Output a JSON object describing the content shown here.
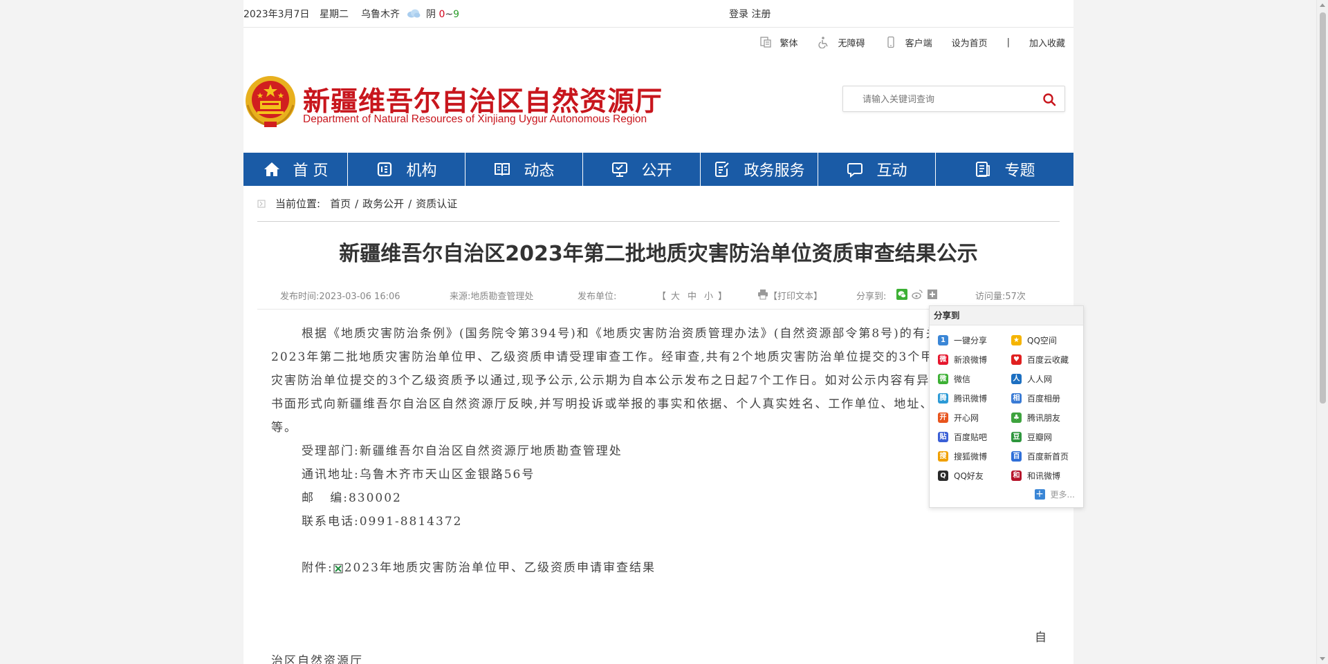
{
  "topbar": {
    "date": "2023年3月7日",
    "weekday": "星期二",
    "city": "乌鲁木齐",
    "weather_label": "阴",
    "temp_low": "0",
    "temp_sep": "~",
    "temp_high": "9",
    "login": "登录",
    "register": "注册"
  },
  "quick_links": {
    "traditional": "繁体",
    "accessibility": "无障碍",
    "client": "客户端",
    "set_home": "设为首页",
    "separator": "|",
    "bookmark": "加入收藏"
  },
  "logo": {
    "cn_name": "新疆维吾尔自治区自然资源厅",
    "en_name": "Department of Natural Resources of Xinjiang Uygur Autonomous Region"
  },
  "search": {
    "placeholder": "请输入关键词查询"
  },
  "nav": {
    "items": [
      {
        "label": "首 页",
        "icon": "home-icon"
      },
      {
        "label": "机构",
        "icon": "org-icon"
      },
      {
        "label": "动态",
        "icon": "news-icon"
      },
      {
        "label": "公开",
        "icon": "public-icon"
      },
      {
        "label": "政务服务",
        "icon": "service-icon"
      },
      {
        "label": "互动",
        "icon": "chat-icon"
      },
      {
        "label": "专题",
        "icon": "topic-icon"
      }
    ]
  },
  "breadcrumb": {
    "prefix": "当前位置:",
    "home": "首页",
    "level1": "政务公开",
    "level2": "资质认证",
    "sep": "/"
  },
  "article": {
    "title": "新疆维吾尔自治区2023年第二批地质灾害防治单位资质审查结果公示",
    "meta": {
      "publish_time": "发布时间:2023-03-06 16:06",
      "source": "来源:地质勘查管理处",
      "publisher": "发布单位:",
      "font_open": "【",
      "font_large": "大",
      "font_medium": "中",
      "font_small": "小",
      "font_close": "】",
      "print": "【打印文本】",
      "share_to": "分享到:",
      "visits": "访问量:57次"
    },
    "paragraph": "根据《地质灾害防治条例》(国务院令第394号)和《地质灾害防治资质管理办法》(自然资源部令第8号)的有关规定,我厅开展了2023年第二批地质灾害防治单位甲、乙级资质申请受理审查工作。经审查,共有2个地质灾害防治单位提交的3个甲级资质和3个地质灾害防治单位提交的3个乙级资质予以通过,现予公示,公示期为自本公示发布之日起7个工作日。如对公示内容有异议,请在公示期内以书面形式向新疆维吾尔自治区自然资源厅反映,并写明投诉或举报的事实和依据、个人真实姓名、工作单位、地址、邮编和联系方式等。",
    "dept": "受理部门:新疆维吾尔自治区自然资源厅地质勘查管理处",
    "address": "通讯地址:乌鲁木齐市天山区金银路56号",
    "postcode": "邮   编:830002",
    "phone": "联系电话:0991-8814372",
    "attach_label": "附件:",
    "attach_name": "2023年地质灾害防治单位甲、乙级资质申请审查结果",
    "sign_right": "自",
    "sign_left": "治区自然资源厅"
  },
  "share_popup": {
    "header": "分享到",
    "items": [
      {
        "label": "一键分享",
        "color": "#3a86d6",
        "glyph": "1"
      },
      {
        "label": "QQ空间",
        "color": "#f5b400",
        "glyph": "★"
      },
      {
        "label": "新浪微博",
        "color": "#e6162d",
        "glyph": "微"
      },
      {
        "label": "百度云收藏",
        "color": "#e02020",
        "glyph": "♥"
      },
      {
        "label": "微信",
        "color": "#3cb034",
        "glyph": "微"
      },
      {
        "label": "人人网",
        "color": "#1c6fc1",
        "glyph": "人"
      },
      {
        "label": "腾讯微博",
        "color": "#2c9ad6",
        "glyph": "腾"
      },
      {
        "label": "百度相册",
        "color": "#3a7bd5",
        "glyph": "相"
      },
      {
        "label": "开心网",
        "color": "#e8541d",
        "glyph": "开"
      },
      {
        "label": "腾讯朋友",
        "color": "#3ea33e",
        "glyph": "♣"
      },
      {
        "label": "百度贴吧",
        "color": "#3a5fd6",
        "glyph": "贴"
      },
      {
        "label": "豆瓣网",
        "color": "#2e963d",
        "glyph": "豆"
      },
      {
        "label": "搜狐微博",
        "color": "#f0a000",
        "glyph": "搜"
      },
      {
        "label": "百度新首页",
        "color": "#2f6fd8",
        "glyph": "百"
      },
      {
        "label": "QQ好友",
        "color": "#2a2a2a",
        "glyph": "Q"
      },
      {
        "label": "和讯微博",
        "color": "#b5132a",
        "glyph": "和"
      }
    ],
    "more": "更多..."
  },
  "colors": {
    "nav_bg": "#1a5ba6",
    "brand_red": "#c8161d"
  }
}
